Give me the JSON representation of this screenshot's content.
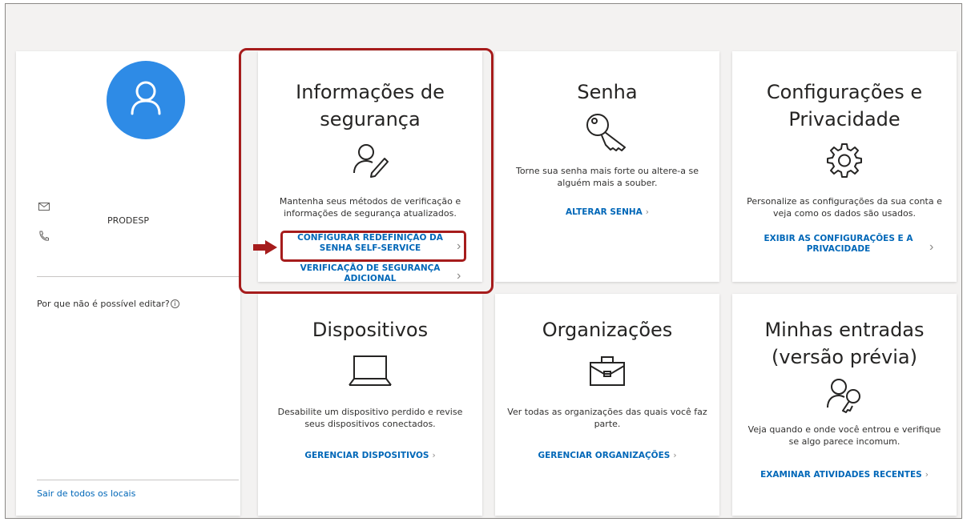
{
  "profile": {
    "org_name": "PRODESP",
    "why_cant_edit": "Por que não é possível editar?",
    "signout": "Sair de todos os locais"
  },
  "cards": {
    "security_info": {
      "title_line1": "Informações de",
      "title_line2": "segurança",
      "desc_line1": "Mantenha seus métodos de verificação e",
      "desc_line2": "informações de segurança atualizados.",
      "link1_line1": "CONFIGURAR REDEFINIÇÃO DA",
      "link1_line2": "SENHA SELF-SERVICE",
      "link2_line1": "VERIFICAÇÃO DE SEGURANÇA",
      "link2_line2": "ADICIONAL",
      "icon": "user-edit-icon"
    },
    "password": {
      "title": "Senha",
      "desc_line1": "Torne sua senha mais forte ou altere-a se",
      "desc_line2": "alguém mais a souber.",
      "link": "ALTERAR SENHA",
      "icon": "key-icon"
    },
    "settings_privacy": {
      "title_line1": "Configurações e",
      "title_line2": "Privacidade",
      "desc_line1": "Personalize as configurações da sua conta e",
      "desc_line2": "veja como os dados são usados.",
      "link_line1": "EXIBIR AS CONFIGURAÇÕES E A",
      "link_line2": "PRIVACIDADE",
      "icon": "gear-icon"
    },
    "devices": {
      "title": "Dispositivos",
      "desc_line1": "Desabilite um dispositivo perdido e revise",
      "desc_line2": "seus dispositivos conectados.",
      "link": "GERENCIAR DISPOSITIVOS",
      "icon": "laptop-icon"
    },
    "organizations": {
      "title": "Organizações",
      "desc_line1": "Ver todas as organizações das quais você faz",
      "desc_line2": "parte.",
      "link": "GERENCIAR ORGANIZAÇÕES",
      "icon": "briefcase-icon"
    },
    "sign_ins": {
      "title_line1": "Minhas entradas",
      "title_line2": "(versão prévia)",
      "desc_line1": "Veja quando e onde você entrou e verifique",
      "desc_line2": "se algo parece incomum.",
      "link": "EXAMINAR ATIVIDADES RECENTES",
      "icon": "user-key-icon"
    }
  },
  "chevron": "›",
  "colors": {
    "accent": "#0067b8",
    "avatar": "#2e8be6",
    "highlight": "#a61c1c"
  }
}
